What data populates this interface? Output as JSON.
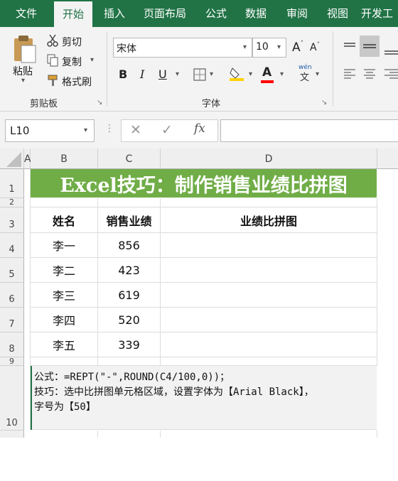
{
  "ribbon_tabs": [
    "文件",
    "开始",
    "插入",
    "页面布局",
    "公式",
    "数据",
    "审阅",
    "视图",
    "开发工"
  ],
  "active_tab": "开始",
  "clipboard": {
    "paste": "粘贴",
    "cut": "剪切",
    "copy": "复制",
    "format_painter": "格式刷",
    "group_label": "剪贴板"
  },
  "font": {
    "name": "宋体",
    "size": "10",
    "grow": "A",
    "shrink": "A",
    "bold": "B",
    "italic": "I",
    "underline": "U",
    "font_color_glyph": "A",
    "phonetic_glyph": "wén",
    "group_label": "字体"
  },
  "formula_bar": {
    "name_box": "L10",
    "fx": "fx",
    "formula": ""
  },
  "columns": [
    "A",
    "B",
    "C",
    "D"
  ],
  "rows": [
    "1",
    "2",
    "3",
    "4",
    "5",
    "6",
    "7",
    "8",
    "9",
    "10"
  ],
  "sheet": {
    "title": "Excel技巧：制作销售业绩比拼图",
    "headers": [
      "姓名",
      "销售业绩",
      "业绩比拼图"
    ],
    "data": [
      {
        "name": "李一",
        "sales": "856"
      },
      {
        "name": "李二",
        "sales": "423"
      },
      {
        "name": "李三",
        "sales": "619"
      },
      {
        "name": "李四",
        "sales": "520"
      },
      {
        "name": "李五",
        "sales": "339"
      }
    ],
    "note_lines": [
      "公式：=REPT(\"-\",ROUND(C4/100,0))；",
      "技巧：选中比拼图单元格区域，设置字体为【Arial Black】，",
      "字号为【50】"
    ]
  },
  "colors": {
    "excel_green": "#217346",
    "title_fill": "#70ad47",
    "note_fill": "#f2f2f2"
  }
}
